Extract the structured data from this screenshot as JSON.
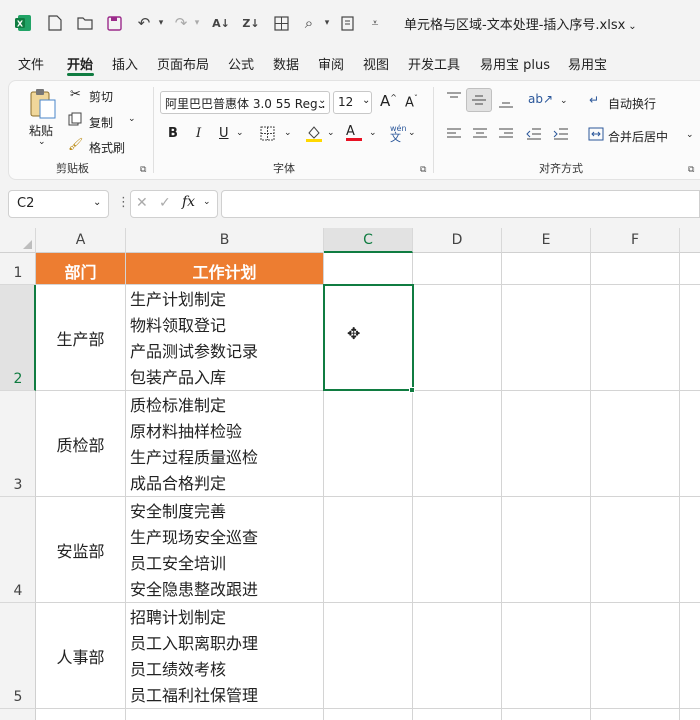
{
  "titlebar": {
    "doc_title": "单元格与区域-文本处理-插入序号.xlsx"
  },
  "tabs": [
    "文件",
    "开始",
    "插入",
    "页面布局",
    "公式",
    "数据",
    "审阅",
    "视图",
    "开发工具",
    "易用宝 plus",
    "易用宝"
  ],
  "ribbon": {
    "clipboard": {
      "paste": "粘贴",
      "cut": "剪切",
      "copy": "复制",
      "format_painter": "格式刷",
      "group": "剪贴板"
    },
    "font": {
      "font_name": "阿里巴巴普惠体 3.0 55 Regu",
      "font_size": "12",
      "bold": "B",
      "italic": "I",
      "underline": "U",
      "phonetic": "wén",
      "group": "字体"
    },
    "alignment": {
      "wrap_text": "自动换行",
      "merge_center": "合并后居中",
      "group": "对齐方式"
    }
  },
  "formula_bar": {
    "name_box": "C2",
    "fx": "fx",
    "formula": ""
  },
  "grid": {
    "columns": [
      "A",
      "B",
      "C",
      "D",
      "E",
      "F"
    ],
    "selected_column": "C",
    "selected_row": "2",
    "header": {
      "row": "1",
      "dept": "部门",
      "plan": "工作计划"
    },
    "rows": [
      {
        "num": "2",
        "dept": "生产部",
        "plans": [
          "生产计划制定",
          "物料领取登记",
          "产品测试参数记录",
          "包装产品入库"
        ]
      },
      {
        "num": "3",
        "dept": "质检部",
        "plans": [
          "质检标准制定",
          "原材料抽样检验",
          "生产过程质量巡检",
          "成品合格判定"
        ]
      },
      {
        "num": "4",
        "dept": "安监部",
        "plans": [
          "安全制度完善",
          "生产现场安全巡查",
          "员工安全培训",
          "安全隐患整改跟进"
        ]
      },
      {
        "num": "5",
        "dept": "人事部",
        "plans": [
          "招聘计划制定",
          "员工入职离职办理",
          "员工绩效考核",
          "员工福利社保管理"
        ]
      }
    ]
  },
  "colors": {
    "header_fill": "#ed7d31",
    "accent": "#107c41"
  }
}
